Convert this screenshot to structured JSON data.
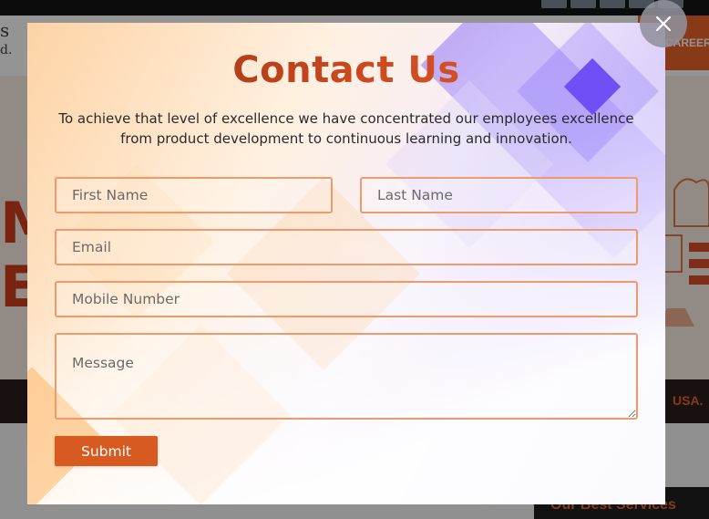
{
  "background_page": {
    "logo_line1": "s",
    "logo_line2": "d.",
    "nav_item": "CAREER",
    "hero_chars": [
      "M",
      "E"
    ],
    "strip_text": "USA.",
    "section_heading": "Our Best Services"
  },
  "modal": {
    "title": "Contact Us",
    "description": "To achieve that level of excellence we have concentrated our employees excellence from product development to continuous learning and innovation.",
    "fields": {
      "first_name": {
        "placeholder": "First Name",
        "value": ""
      },
      "last_name": {
        "placeholder": "Last Name",
        "value": ""
      },
      "email": {
        "placeholder": "Email",
        "value": ""
      },
      "mobile": {
        "placeholder": "Mobile Number",
        "value": ""
      },
      "message": {
        "placeholder": "Message",
        "value": ""
      }
    },
    "submit_label": "Submit",
    "close_icon": "close-icon"
  },
  "colors": {
    "accent": "#d75b20",
    "title_gradient_start": "#8c2f14",
    "title_gradient_end": "#e05b2a",
    "field_border": "#ef9a6a"
  }
}
